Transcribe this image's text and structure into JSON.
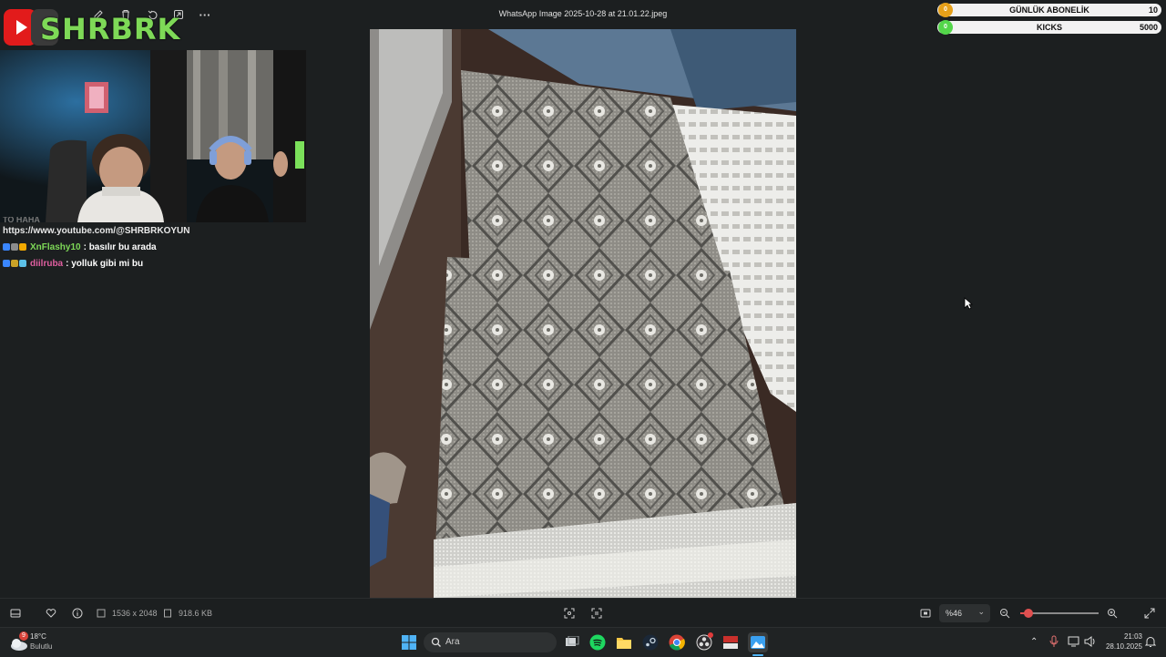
{
  "viewer": {
    "file_title": "WhatsApp Image 2025-10-28 at 21.01.22.jpeg",
    "toolbar_icons": [
      "edit-icon",
      "delete-icon",
      "copy-icon",
      "rotate-icon",
      "share-icon",
      "more-icon"
    ],
    "more_glyph": "···"
  },
  "overlay": {
    "logo_text": "SHRBRK",
    "goals": [
      {
        "label": "GÜNLÜK ABONELİK",
        "count": "0",
        "target": "10",
        "color": "#e6a019"
      },
      {
        "label": "KICKS",
        "count": "0",
        "target": "5000",
        "color": "#53d64a"
      }
    ]
  },
  "chat": {
    "partial_line": "TO HAHA",
    "link": "https://www.youtube.com/@SHRBRKOYUN",
    "messages": [
      {
        "user": "XnFlashy10",
        "text": ": basılır bu arada",
        "user_color": "#7ed957",
        "badges": [
          "#3a86ff",
          "#8c8c8c",
          "#f2a900"
        ]
      },
      {
        "user": "diilruba",
        "text": ": yolluk gibi mi bu",
        "user_color": "#e05fa0",
        "badges": [
          "#3a86ff",
          "#c9a227",
          "#5cc1e8"
        ]
      }
    ]
  },
  "bottom_bar": {
    "dimensions": "1536 x 2048",
    "file_size": "918.6 KB",
    "zoom_label": "%46",
    "zoom_fraction": 0.1
  },
  "taskbar": {
    "weather_temp": "18°C",
    "weather_desc": "Bulutlu",
    "weather_badge": "9",
    "search_placeholder": "Ara",
    "time": "21:03",
    "date": "28.10.2025"
  }
}
